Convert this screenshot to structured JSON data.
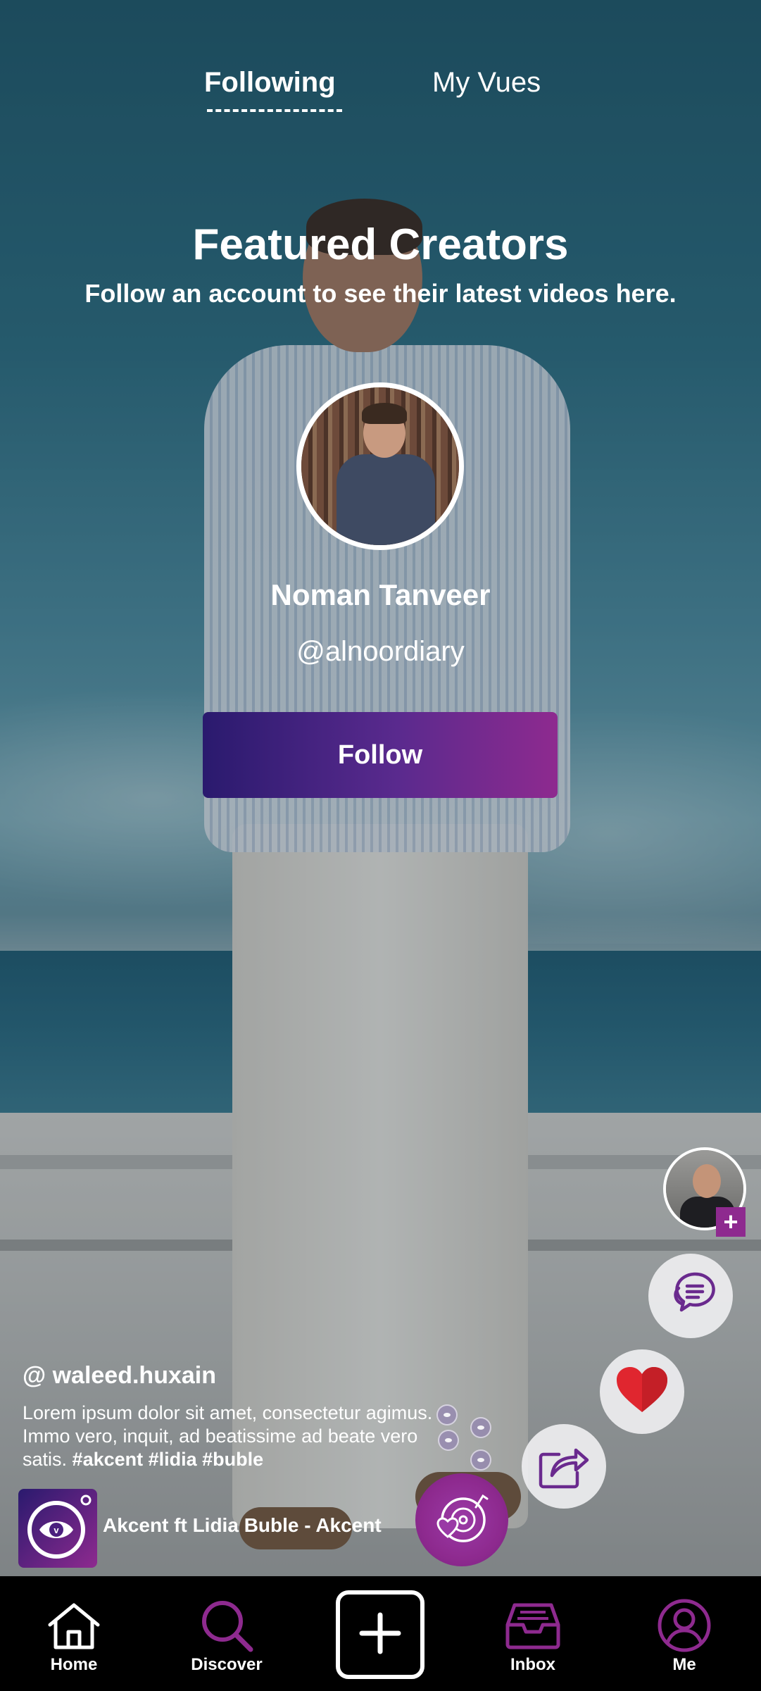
{
  "top_tabs": {
    "following": "Following",
    "my_vues": "My Vues"
  },
  "featured": {
    "title": "Featured Creators",
    "subtitle": "Follow an account to see their latest videos here."
  },
  "creator": {
    "name": "Noman Tanveer",
    "handle": "@alnoordiary",
    "follow_label": "Follow"
  },
  "post": {
    "username": "@ waleed.huxain",
    "caption": "Lorem ipsum dolor sit amet, consectetur agimus. Immo vero, inquit, ad beatissime ad beate vero satis.",
    "hashtags": "#akcent #lidia #buble",
    "music": "Akcent ft Lidia Buble - Akcent",
    "side_plus": "+"
  },
  "bottom_nav": {
    "home": "Home",
    "discover": "Discover",
    "inbox": "Inbox",
    "me": "Me"
  },
  "colors": {
    "accent": "#8e2a8f",
    "gradient_start": "#2a1a6e",
    "like_red": "#e0262f",
    "icon_purple": "#6a2a8e"
  },
  "icons": {
    "home": "home-icon",
    "discover": "search-icon",
    "create": "plus-icon",
    "inbox": "inbox-icon",
    "me": "user-icon",
    "comment": "comment-icon",
    "like": "heart-icon",
    "share": "share-icon",
    "music": "music-disc-icon"
  }
}
